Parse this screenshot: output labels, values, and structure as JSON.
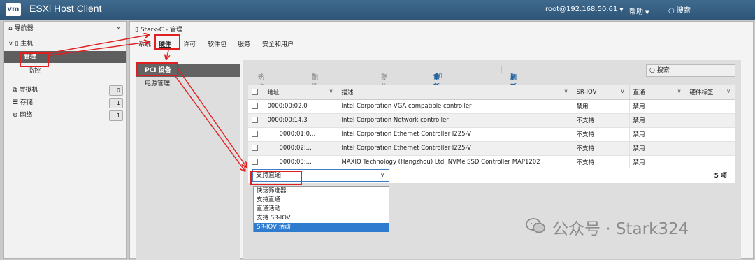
{
  "topbar": {
    "logo": "vm",
    "title": "ESXi Host Client",
    "user": "root@192.168.50.61",
    "help": "帮助",
    "search": "搜索"
  },
  "nav": {
    "title": "导航器",
    "host": "主机",
    "manage": "管理",
    "monitor": "监控",
    "items": [
      {
        "label": "虚拟机",
        "count": "0"
      },
      {
        "label": "存储",
        "count": "1"
      },
      {
        "label": "网络",
        "count": "1"
      }
    ]
  },
  "panel": {
    "title": "Stark-C - 管理",
    "tabs": [
      "系统",
      "硬件",
      "许可",
      "软件包",
      "服务",
      "安全和用户"
    ],
    "left_items": [
      "PCI 设备",
      "电源管理"
    ]
  },
  "toolbar": {
    "toggle": "切换直通",
    "sriov": "配置 SR-IOV",
    "hwlabel": "硬件标签",
    "reboot": "重新引导主机",
    "refresh": "刷新",
    "search_placeholder": "搜索"
  },
  "table": {
    "headers": [
      "地址",
      "描述",
      "SR-IOV",
      "直通",
      "硬件标签"
    ],
    "rows": [
      {
        "addr": "0000:00:02.0",
        "desc": "Intel Corporation VGA compatible controller",
        "sriov": "禁用",
        "pass": "禁用"
      },
      {
        "addr": "0000:00:14.3",
        "desc": "Intel Corporation Network controller",
        "sriov": "不支持",
        "pass": "禁用"
      },
      {
        "addr": "0000:01:0...",
        "desc": "Intel Corporation Ethernet Controller I225-V",
        "sriov": "不支持",
        "pass": "禁用"
      },
      {
        "addr": "0000:02:...",
        "desc": "Intel Corporation Ethernet Controller I225-V",
        "sriov": "不支持",
        "pass": "禁用"
      },
      {
        "addr": "0000:03:...",
        "desc": "MAXIO Technology (Hangzhou) Ltd. NVMe SSD Controller MAP1202",
        "sriov": "不支持",
        "pass": "禁用"
      }
    ],
    "filter_value": "支持直通",
    "count": "5 项"
  },
  "dropdown": {
    "options": [
      "快速筛选器...",
      "支持直通",
      "直通活动",
      "支持 SR-IOV",
      "SR-IOV 活动"
    ],
    "selected": "SR-IOV 活动"
  },
  "watermark": "公众号 · Stark324",
  "colors": {
    "topbar": "#2e5577",
    "accent": "#1f5f9b",
    "selected": "#2f7bd0",
    "annotation": "#e02020"
  }
}
